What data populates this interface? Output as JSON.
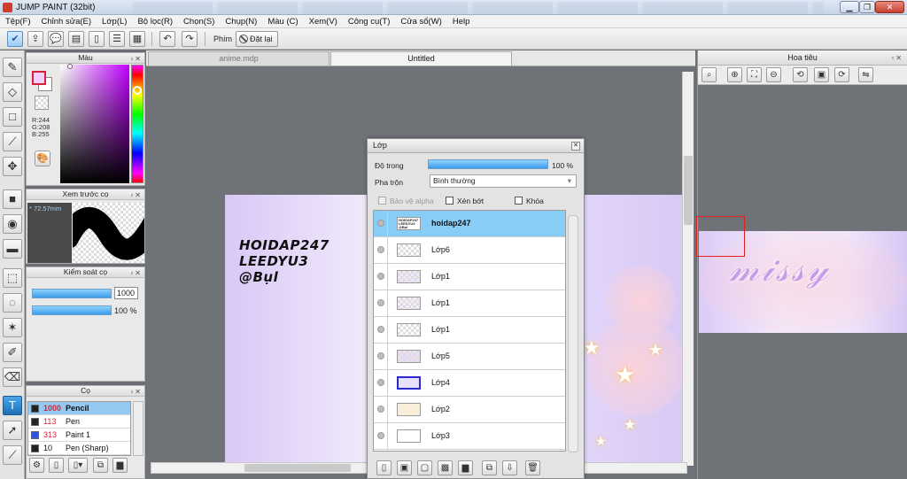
{
  "window": {
    "title": "JUMP PAINT (32bit)",
    "min": "▁",
    "max": "❐",
    "close": "✕"
  },
  "menu": [
    "Tệp(F)",
    "Chỉnh sửa(E)",
    "Lớp(L)",
    "Bộ lọc(R)",
    "Chọn(S)",
    "Chụp(N)",
    "Màu (C)",
    "Xem(V)",
    "Công cụ(T)",
    "Cửa sổ(W)",
    "Help"
  ],
  "toolbar": {
    "key_label": "Phím",
    "reset_label": "Đặt lại"
  },
  "color_panel": {
    "title": "Màu",
    "r": "R:244",
    "g": "G:208",
    "b": "B:255",
    "fg_color": "#f4d0ff"
  },
  "brush_preview": {
    "title": "Xem trước cọ",
    "size": "* 72.57mm"
  },
  "control_panel": {
    "title": "Kiểm soát cọ",
    "size_value": "1000",
    "opacity_value": "100 %"
  },
  "brush_panel": {
    "title": "Cọ",
    "items": [
      {
        "num": "1000",
        "name": "Pencil",
        "color": "#222222"
      },
      {
        "num": "113",
        "name": "Pen",
        "color": "#222222"
      },
      {
        "num": "313",
        "name": "Paint 1",
        "color": "#3355dd"
      },
      {
        "num": "10",
        "name": "Pen (Sharp)",
        "color": "#222222"
      }
    ]
  },
  "doc_tabs": [
    "anime.mdp",
    "Untitled"
  ],
  "canvas_text": [
    "HOIDAP247",
    "LEEDYU3",
    "@Bụl"
  ],
  "layer_window": {
    "title": "Lớp",
    "opacity_label": "Độ trong",
    "opacity_value": "100 %",
    "blend_label": "Pha trộn",
    "blend_value": "Bình thường",
    "protect_alpha": "Bảo vệ alpha",
    "clipping": "Xén bớt",
    "lock": "Khóa",
    "layers": [
      {
        "name": "hoidap247",
        "selected": true,
        "thumb_text": "HOIDAP247 LEEDYU3 @Bụl"
      },
      {
        "name": "Lớp6"
      },
      {
        "name": "Lớp1"
      },
      {
        "name": "Lớp1"
      },
      {
        "name": "Lớp1"
      },
      {
        "name": "Lớp5"
      },
      {
        "name": "Lớp4"
      },
      {
        "name": "Lớp2"
      },
      {
        "name": "Lớp3"
      }
    ]
  },
  "navigator": {
    "title": "Hoa tiêu"
  }
}
